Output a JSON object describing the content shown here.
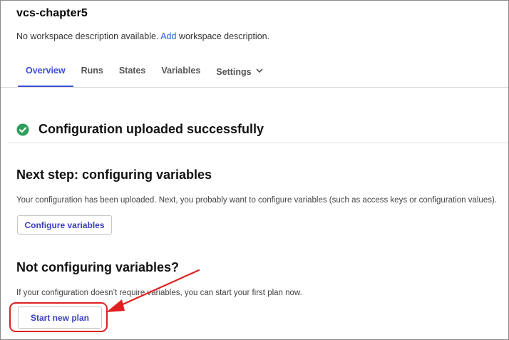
{
  "workspace": {
    "title": "vcs-chapter5",
    "description_prefix": "No workspace description available. ",
    "add_link": "Add",
    "description_suffix": " workspace description."
  },
  "tabs": [
    {
      "label": "Overview",
      "active": true
    },
    {
      "label": "Runs",
      "active": false
    },
    {
      "label": "States",
      "active": false
    },
    {
      "label": "Variables",
      "active": false
    },
    {
      "label": "Settings",
      "active": false,
      "has_dropdown": true
    }
  ],
  "status": {
    "icon": "check-circle-icon",
    "title": "Configuration uploaded successfully",
    "color": "#2e9e5b"
  },
  "next_step": {
    "heading": "Next step: configuring variables",
    "text": "Your configuration has been uploaded. Next, you probably want to configure variables (such as access keys or configuration values).",
    "button": "Configure variables"
  },
  "not_configuring": {
    "heading": "Not configuring variables?",
    "text": "If your configuration doesn’t require variables, you can start your first plan now.",
    "button": "Start new plan"
  },
  "colors": {
    "accent": "#3d4ed8",
    "link": "#2f5fd0",
    "annotation": "#e02020"
  }
}
